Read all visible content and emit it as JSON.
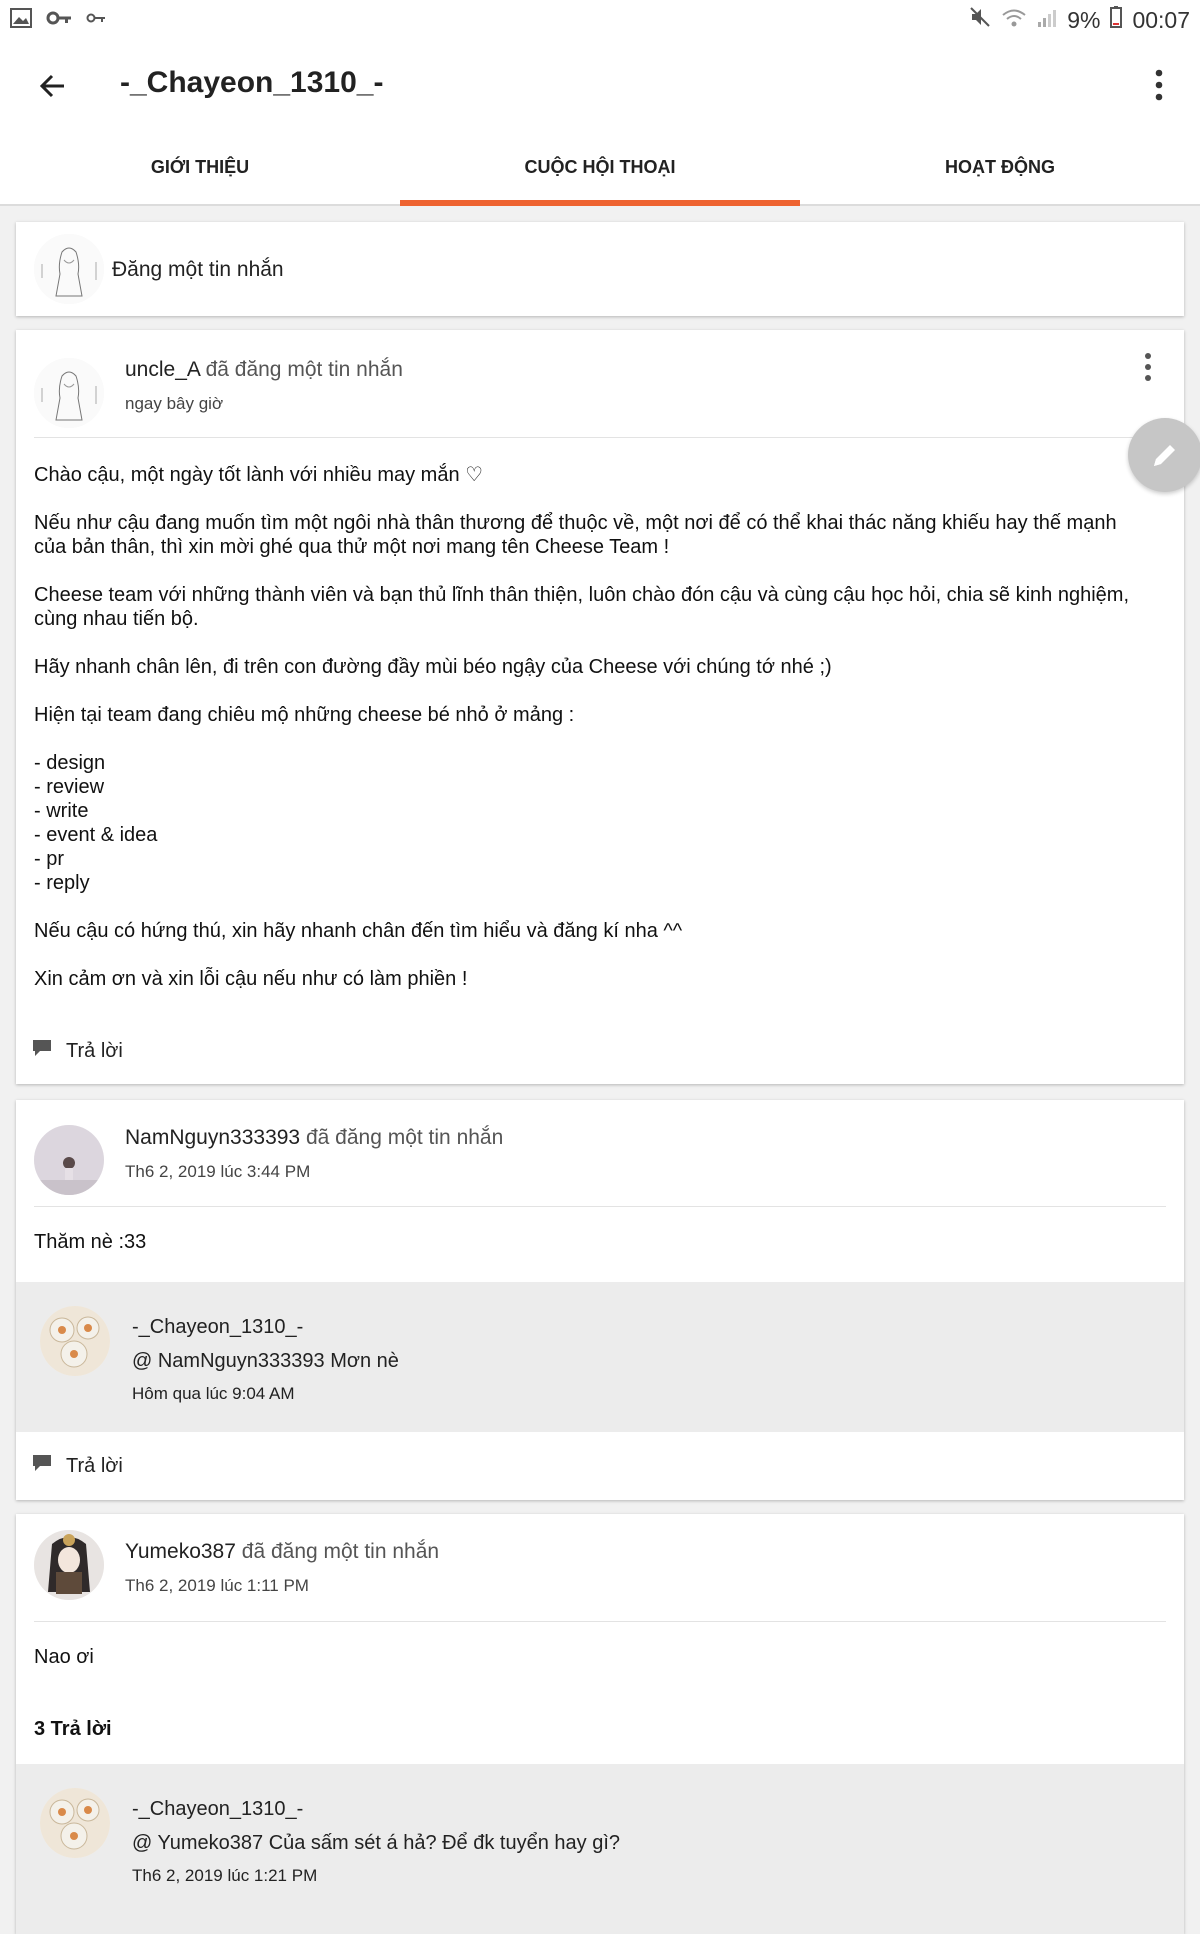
{
  "status_bar": {
    "battery": "9%",
    "time": "00:07"
  },
  "header": {
    "title": "-_Chayeon_1310_-"
  },
  "tabs": [
    {
      "label": "GIỚI THIỆU",
      "active": false
    },
    {
      "label": "CUỘC HỘI THOẠI",
      "active": true
    },
    {
      "label": "HOẠT ĐỘNG",
      "active": false
    }
  ],
  "compose": {
    "label": "Đăng một tin nhắn"
  },
  "posts": [
    {
      "user": "uncle_A",
      "action": "đã đăng một tin nhắn",
      "time": "ngay bây giờ",
      "paragraphs": [
        "Chào cậu, một ngày tốt lành với nhiều may mắn ♡",
        "Nếu như cậu đang muốn tìm một ngôi nhà thân thương để thuộc về, một nơi để có thể khai thác năng khiếu hay thế mạnh của bản thân, thì xin mời ghé qua thử một nơi mang tên Cheese Team !",
        "Cheese team với những thành viên và bạn thủ lĩnh thân thiện, luôn chào đón cậu và cùng cậu học hỏi, chia sẽ kinh nghiệm, cùng nhau tiến bộ.",
        "Hãy nhanh chân lên, đi trên con đường đầy mùi béo ngậy của Cheese với chúng tớ nhé ;)",
        "Hiện tại team đang chiêu mộ những cheese bé nhỏ ở mảng :",
        "- design\n- review\n- write\n- event & idea\n- pr\n- reply",
        "Nếu cậu có hứng thú, xin hãy nhanh chân đến tìm hiểu và đăng kí nha ^^",
        "Xin cảm ơn và xin lỗi cậu nếu như có làm phiền !"
      ],
      "reply_label": "Trả lời"
    },
    {
      "user": "NamNguyn333393",
      "action": "đã đăng một tin nhắn",
      "time": "Th6 2, 2019 lúc 3:44 PM",
      "text": "Thăm nè :33",
      "reply": {
        "name": "-_Chayeon_1310_-",
        "text": "@ NamNguyn333393  Mơn nè",
        "time": "Hôm qua lúc 9:04 AM"
      },
      "reply_label": "Trả lời"
    },
    {
      "user": "Yumeko387",
      "action": "đã đăng một tin nhắn",
      "time": "Th6 2, 2019 lúc 1:11 PM",
      "text": "Nao ơi",
      "reply_count": "3 Trả lời",
      "reply": {
        "name": "-_Chayeon_1310_-",
        "text": "@ Yumeko387  Của sấm sét á hả? Để đk tuyển hay gì?",
        "time": "Th6 2, 2019 lúc 1:21 PM"
      }
    }
  ],
  "colors": {
    "accent": "#ee6330",
    "reply_bg": "#ececec",
    "fab": "#c6c6c6"
  },
  "icons": [
    "back-arrow-icon",
    "more-vert-icon",
    "pencil-icon",
    "comment-icon",
    "image-icon",
    "key-icon",
    "mute-icon",
    "wifi-icon",
    "signal-icon",
    "battery-icon"
  ]
}
